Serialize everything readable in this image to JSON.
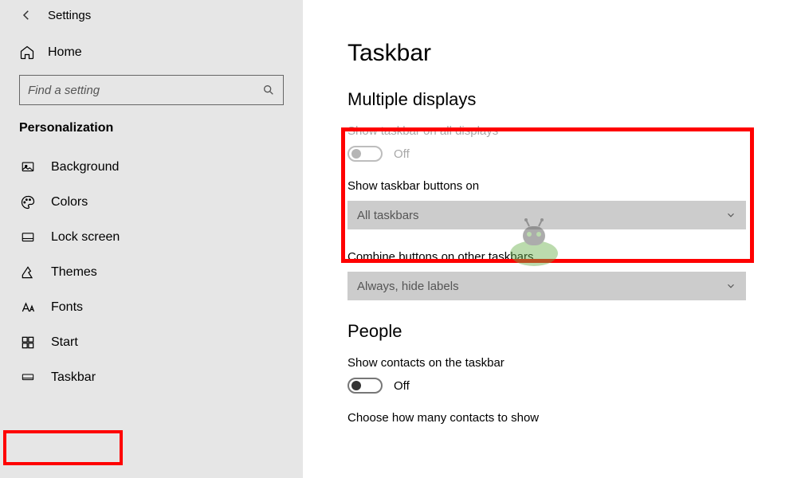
{
  "topbar": {
    "settings_label": "Settings"
  },
  "home": {
    "label": "Home"
  },
  "search": {
    "placeholder": "Find a setting"
  },
  "sidebar": {
    "section_title": "Personalization",
    "items": [
      {
        "label": "Background"
      },
      {
        "label": "Colors"
      },
      {
        "label": "Lock screen"
      },
      {
        "label": "Themes"
      },
      {
        "label": "Fonts"
      },
      {
        "label": "Start"
      },
      {
        "label": "Taskbar"
      }
    ]
  },
  "main": {
    "page_title": "Taskbar",
    "section_multiple": "Multiple displays",
    "show_all": {
      "label": "Show taskbar on all displays",
      "state": "Off"
    },
    "show_buttons": {
      "label": "Show taskbar buttons on",
      "value": "All taskbars"
    },
    "combine": {
      "label": "Combine buttons on other taskbars",
      "value": "Always, hide labels"
    },
    "section_people": "People",
    "show_contacts": {
      "label": "Show contacts on the taskbar",
      "state": "Off"
    },
    "choose_contacts": "Choose how many contacts to show"
  }
}
